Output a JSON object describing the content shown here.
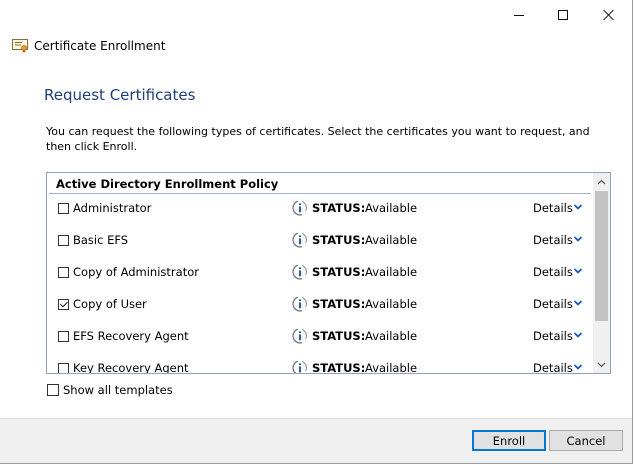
{
  "window": {
    "title": "Certificate Enrollment",
    "controls": [
      "minimize",
      "maximize",
      "close"
    ]
  },
  "header": {
    "title": "Request Certificates",
    "description": "You can request the following types of certificates. Select the certificates you want to request, and then click Enroll."
  },
  "policy": {
    "name": "Active Directory Enrollment Policy"
  },
  "certificates": [
    {
      "name": "Administrator",
      "checked": false,
      "status_label": "STATUS:",
      "status": "Available",
      "details": "Details"
    },
    {
      "name": "Basic EFS",
      "checked": false,
      "status_label": "STATUS:",
      "status": "Available",
      "details": "Details"
    },
    {
      "name": "Copy of Administrator",
      "checked": false,
      "status_label": "STATUS:",
      "status": "Available",
      "details": "Details"
    },
    {
      "name": "Copy of User",
      "checked": true,
      "status_label": "STATUS:",
      "status": "Available",
      "details": "Details"
    },
    {
      "name": "EFS Recovery Agent",
      "checked": false,
      "status_label": "STATUS:",
      "status": "Available",
      "details": "Details"
    },
    {
      "name": "Key Recovery Agent",
      "checked": false,
      "status_label": "STATUS:",
      "status": "Available",
      "details": "Details"
    }
  ],
  "options": {
    "show_all_templates": "Show all templates",
    "show_all_checked": false
  },
  "buttons": {
    "enroll": "Enroll",
    "cancel": "Cancel"
  },
  "colors": {
    "header_text": "#1f3f7a",
    "accent": "#0078d7",
    "chevron": "#1e5aa8"
  },
  "icons": {
    "app": "certificate-icon",
    "status": "info-icon",
    "details": "chevron-down-icon"
  }
}
